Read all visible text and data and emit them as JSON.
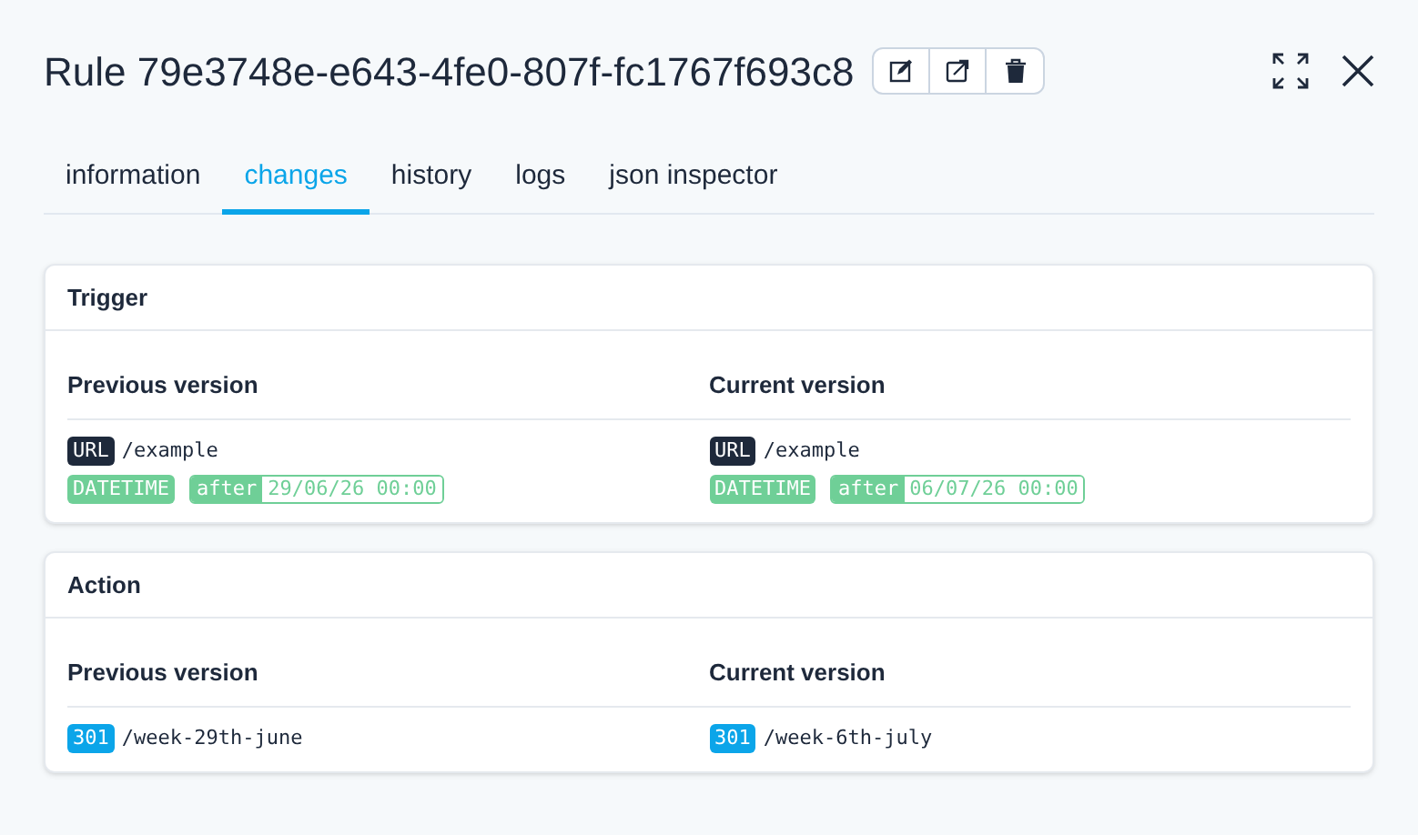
{
  "title": "Rule 79e3748e-e643-4fe0-807f-fc1767f693c8",
  "tabs": [
    {
      "label": "information",
      "selected": false
    },
    {
      "label": "changes",
      "selected": true
    },
    {
      "label": "history",
      "selected": false
    },
    {
      "label": "logs",
      "selected": false
    },
    {
      "label": "json inspector",
      "selected": false
    }
  ],
  "sections": [
    {
      "title": "Trigger",
      "columns": [
        {
          "heading": "Previous version",
          "lines": [
            {
              "kind": "tagged",
              "tag": "URL",
              "color": "#1e293b",
              "value": "/example"
            },
            {
              "kind": "datetime",
              "tag": "DATETIME",
              "operator": "after",
              "value": "29/06/26 00:00"
            }
          ]
        },
        {
          "heading": "Current version",
          "lines": [
            {
              "kind": "tagged",
              "tag": "URL",
              "color": "#1e293b",
              "value": "/example"
            },
            {
              "kind": "datetime",
              "tag": "DATETIME",
              "operator": "after",
              "value": "06/07/26 00:00"
            }
          ]
        }
      ]
    },
    {
      "title": "Action",
      "columns": [
        {
          "heading": "Previous version",
          "lines": [
            {
              "kind": "tagged",
              "tag": "301",
              "color": "#0ba5e9",
              "value": "/week-29th-june"
            }
          ]
        },
        {
          "heading": "Current version",
          "lines": [
            {
              "kind": "tagged",
              "tag": "301",
              "color": "#0ba5e9",
              "value": "/week-6th-july"
            }
          ]
        }
      ]
    }
  ]
}
